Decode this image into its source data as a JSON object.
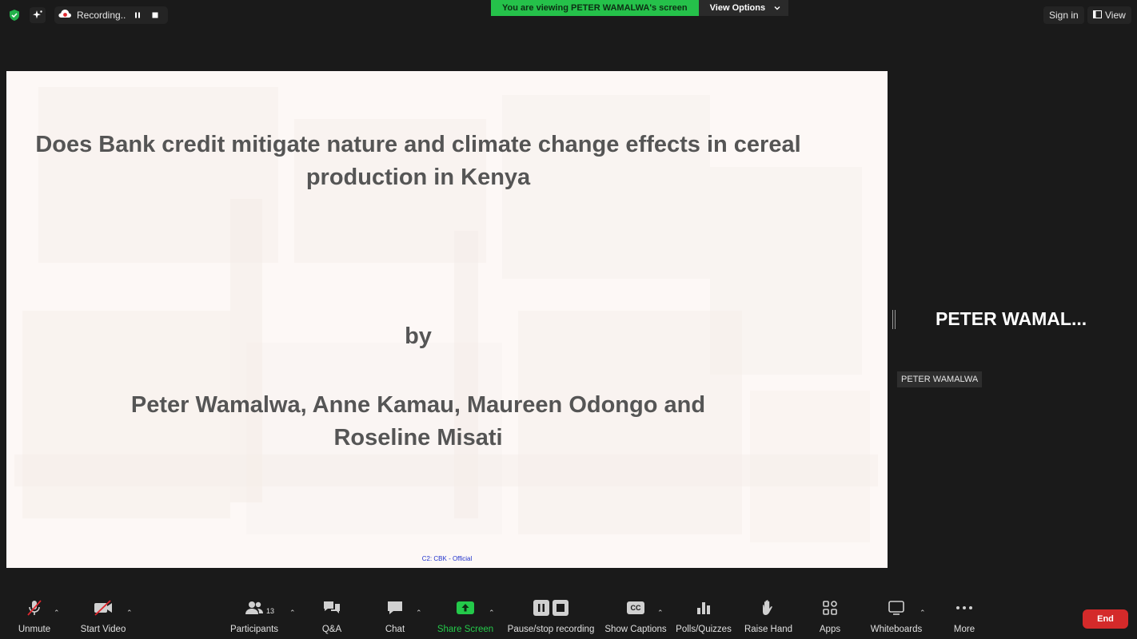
{
  "topbar": {
    "recording_label": "Recording...",
    "viewing_banner": "You are viewing PETER WAMALWA's screen",
    "view_options": "View Options",
    "sign_in": "Sign in",
    "view": "View"
  },
  "slide": {
    "title_line1": "Does Bank credit mitigate nature and climate change effects in cereal",
    "title_line2": "production in Kenya",
    "by": "by",
    "authors_line1": "Peter Wamalwa, Anne Kamau, Maureen Odongo and",
    "authors_line2": "Roseline Misati",
    "classification": "C2: CBK - Official"
  },
  "participant": {
    "display_name": "PETER  WAMAL...",
    "name_tag": "PETER WAMALWA"
  },
  "toolbar": {
    "unmute": "Unmute",
    "start_video": "Start Video",
    "participants": "Participants",
    "participants_count": "13",
    "qa": "Q&A",
    "chat": "Chat",
    "share_screen": "Share Screen",
    "pause_stop_recording": "Pause/stop recording",
    "show_captions": "Show Captions",
    "captions_glyph": "CC",
    "polls": "Polls/Quizzes",
    "raise_hand": "Raise Hand",
    "apps": "Apps",
    "whiteboards": "Whiteboards",
    "more": "More",
    "end": "End"
  },
  "colors": {
    "background": "#1a1a1a",
    "banner_green": "#25c14a",
    "share_green": "#24c94a",
    "end_red": "#d42a2a",
    "slide_bg": "#fdf8f6",
    "slide_text": "#555555"
  }
}
